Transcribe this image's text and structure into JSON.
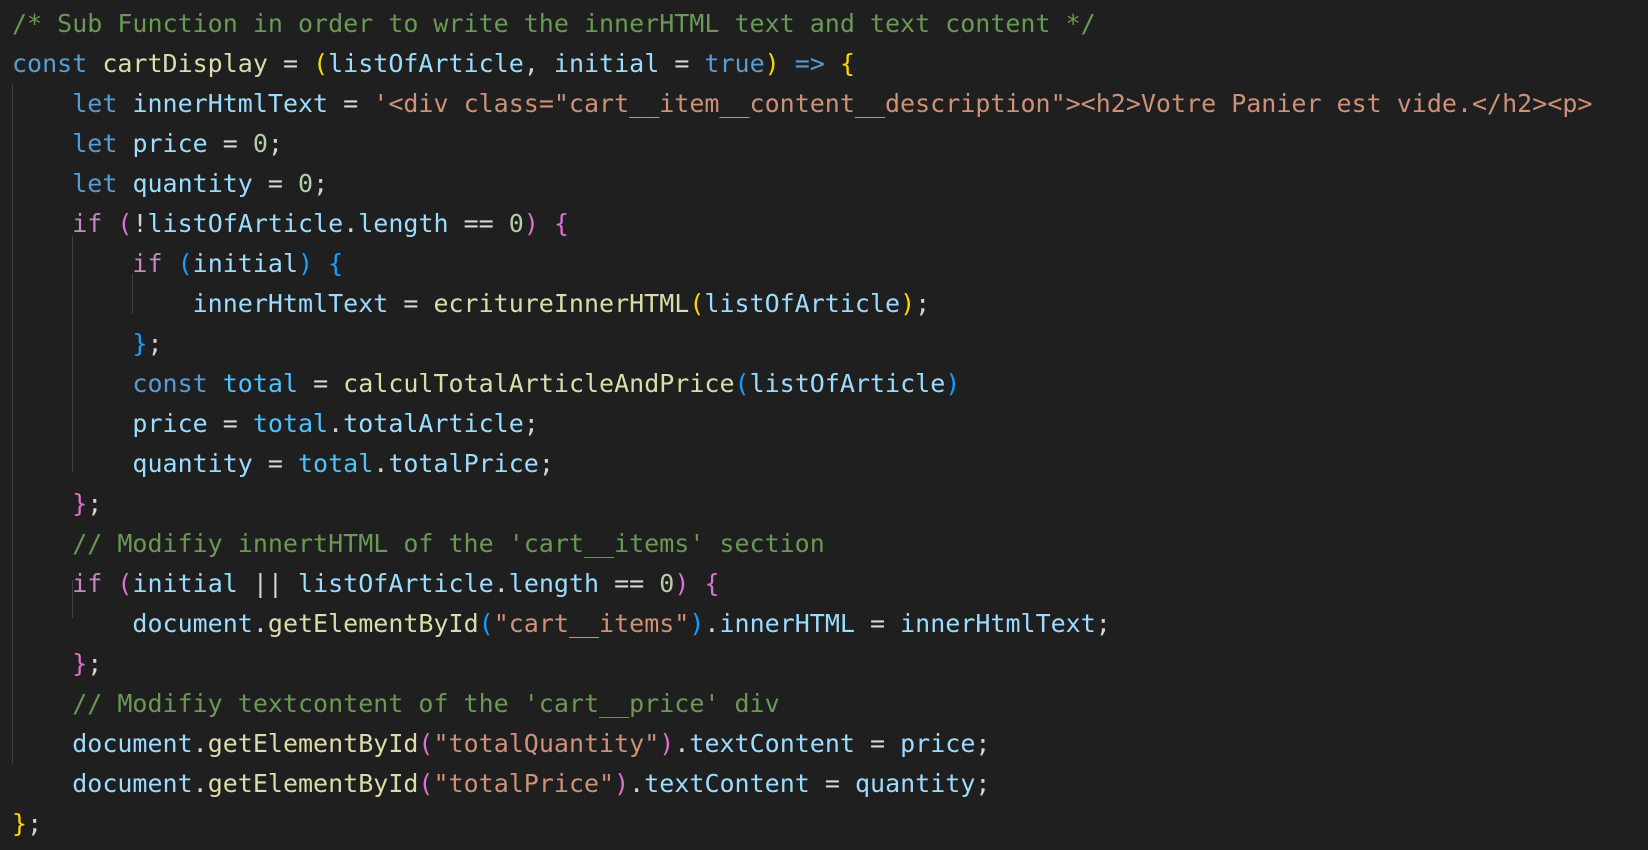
{
  "editor": {
    "theme_colors": {
      "background": "#1f1f1f",
      "plain": "#d4d4d4",
      "comment": "#6a9955",
      "keyword_storage": "#569cd6",
      "keyword_control": "#c586c0",
      "function": "#dcdcaa",
      "variable": "#9cdcfe",
      "constant": "#4fc1ff",
      "string": "#ce9178",
      "number": "#b5cea8",
      "bracket_gold": "#ffd700",
      "bracket_pink": "#da70d6",
      "bracket_blue": "#179fff",
      "indent_guide": "#404040"
    },
    "lines": [
      [
        {
          "t": "/* Sub Function in order to write the innerHTML text and text content */",
          "c": "comment"
        }
      ],
      [
        {
          "t": "const",
          "c": "keyword_storage"
        },
        {
          "t": " ",
          "c": "plain"
        },
        {
          "t": "cartDisplay",
          "c": "function"
        },
        {
          "t": " = ",
          "c": "plain"
        },
        {
          "t": "(",
          "c": "bracket_gold"
        },
        {
          "t": "listOfArticle",
          "c": "variable"
        },
        {
          "t": ", ",
          "c": "plain"
        },
        {
          "t": "initial",
          "c": "variable"
        },
        {
          "t": " = ",
          "c": "plain"
        },
        {
          "t": "true",
          "c": "keyword_storage"
        },
        {
          "t": ")",
          "c": "bracket_gold"
        },
        {
          "t": " ",
          "c": "plain"
        },
        {
          "t": "=>",
          "c": "keyword_storage"
        },
        {
          "t": " ",
          "c": "plain"
        },
        {
          "t": "{",
          "c": "bracket_gold"
        }
      ],
      [
        {
          "t": "    ",
          "c": "plain"
        },
        {
          "t": "let",
          "c": "keyword_storage"
        },
        {
          "t": " ",
          "c": "plain"
        },
        {
          "t": "innerHtmlText",
          "c": "variable"
        },
        {
          "t": " = ",
          "c": "plain"
        },
        {
          "t": "'<div class=\"cart__item__content__description\"><h2>Votre Panier est vide.</h2><p>",
          "c": "string"
        }
      ],
      [
        {
          "t": "    ",
          "c": "plain"
        },
        {
          "t": "let",
          "c": "keyword_storage"
        },
        {
          "t": " ",
          "c": "plain"
        },
        {
          "t": "price",
          "c": "variable"
        },
        {
          "t": " = ",
          "c": "plain"
        },
        {
          "t": "0",
          "c": "number"
        },
        {
          "t": ";",
          "c": "plain"
        }
      ],
      [
        {
          "t": "    ",
          "c": "plain"
        },
        {
          "t": "let",
          "c": "keyword_storage"
        },
        {
          "t": " ",
          "c": "plain"
        },
        {
          "t": "quantity",
          "c": "variable"
        },
        {
          "t": " = ",
          "c": "plain"
        },
        {
          "t": "0",
          "c": "number"
        },
        {
          "t": ";",
          "c": "plain"
        }
      ],
      [
        {
          "t": "    ",
          "c": "plain"
        },
        {
          "t": "if",
          "c": "keyword_control"
        },
        {
          "t": " ",
          "c": "plain"
        },
        {
          "t": "(",
          "c": "bracket_pink"
        },
        {
          "t": "!",
          "c": "plain"
        },
        {
          "t": "listOfArticle",
          "c": "variable"
        },
        {
          "t": ".",
          "c": "plain"
        },
        {
          "t": "length",
          "c": "variable"
        },
        {
          "t": " == ",
          "c": "plain"
        },
        {
          "t": "0",
          "c": "number"
        },
        {
          "t": ")",
          "c": "bracket_pink"
        },
        {
          "t": " ",
          "c": "plain"
        },
        {
          "t": "{",
          "c": "bracket_pink"
        }
      ],
      [
        {
          "t": "        ",
          "c": "plain"
        },
        {
          "t": "if",
          "c": "keyword_control"
        },
        {
          "t": " ",
          "c": "plain"
        },
        {
          "t": "(",
          "c": "bracket_blue"
        },
        {
          "t": "initial",
          "c": "variable"
        },
        {
          "t": ")",
          "c": "bracket_blue"
        },
        {
          "t": " ",
          "c": "plain"
        },
        {
          "t": "{",
          "c": "bracket_blue"
        }
      ],
      [
        {
          "t": "            ",
          "c": "plain"
        },
        {
          "t": "innerHtmlText",
          "c": "variable"
        },
        {
          "t": " = ",
          "c": "plain"
        },
        {
          "t": "ecritureInnerHTML",
          "c": "function"
        },
        {
          "t": "(",
          "c": "bracket_gold"
        },
        {
          "t": "listOfArticle",
          "c": "variable"
        },
        {
          "t": ")",
          "c": "bracket_gold"
        },
        {
          "t": ";",
          "c": "plain"
        }
      ],
      [
        {
          "t": "        ",
          "c": "plain"
        },
        {
          "t": "}",
          "c": "bracket_blue"
        },
        {
          "t": ";",
          "c": "plain"
        }
      ],
      [
        {
          "t": "        ",
          "c": "plain"
        },
        {
          "t": "const",
          "c": "keyword_storage"
        },
        {
          "t": " ",
          "c": "plain"
        },
        {
          "t": "total",
          "c": "constant"
        },
        {
          "t": " = ",
          "c": "plain"
        },
        {
          "t": "calculTotalArticleAndPrice",
          "c": "function"
        },
        {
          "t": "(",
          "c": "bracket_blue"
        },
        {
          "t": "listOfArticle",
          "c": "variable"
        },
        {
          "t": ")",
          "c": "bracket_blue"
        }
      ],
      [
        {
          "t": "        ",
          "c": "plain"
        },
        {
          "t": "price",
          "c": "variable"
        },
        {
          "t": " = ",
          "c": "plain"
        },
        {
          "t": "total",
          "c": "constant"
        },
        {
          "t": ".",
          "c": "plain"
        },
        {
          "t": "totalArticle",
          "c": "variable"
        },
        {
          "t": ";",
          "c": "plain"
        }
      ],
      [
        {
          "t": "        ",
          "c": "plain"
        },
        {
          "t": "quantity",
          "c": "variable"
        },
        {
          "t": " = ",
          "c": "plain"
        },
        {
          "t": "total",
          "c": "constant"
        },
        {
          "t": ".",
          "c": "plain"
        },
        {
          "t": "totalPrice",
          "c": "variable"
        },
        {
          "t": ";",
          "c": "plain"
        }
      ],
      [
        {
          "t": "    ",
          "c": "plain"
        },
        {
          "t": "}",
          "c": "bracket_pink"
        },
        {
          "t": ";",
          "c": "plain"
        }
      ],
      [
        {
          "t": "    ",
          "c": "plain"
        },
        {
          "t": "// Modifiy innertHTML of the 'cart__items' section",
          "c": "comment"
        }
      ],
      [
        {
          "t": "    ",
          "c": "plain"
        },
        {
          "t": "if",
          "c": "keyword_control"
        },
        {
          "t": " ",
          "c": "plain"
        },
        {
          "t": "(",
          "c": "bracket_pink"
        },
        {
          "t": "initial",
          "c": "variable"
        },
        {
          "t": " || ",
          "c": "plain"
        },
        {
          "t": "listOfArticle",
          "c": "variable"
        },
        {
          "t": ".",
          "c": "plain"
        },
        {
          "t": "length",
          "c": "variable"
        },
        {
          "t": " == ",
          "c": "plain"
        },
        {
          "t": "0",
          "c": "number"
        },
        {
          "t": ")",
          "c": "bracket_pink"
        },
        {
          "t": " ",
          "c": "plain"
        },
        {
          "t": "{",
          "c": "bracket_pink"
        }
      ],
      [
        {
          "t": "        ",
          "c": "plain"
        },
        {
          "t": "document",
          "c": "variable"
        },
        {
          "t": ".",
          "c": "plain"
        },
        {
          "t": "getElementById",
          "c": "function"
        },
        {
          "t": "(",
          "c": "bracket_blue"
        },
        {
          "t": "\"cart__items\"",
          "c": "string"
        },
        {
          "t": ")",
          "c": "bracket_blue"
        },
        {
          "t": ".",
          "c": "plain"
        },
        {
          "t": "innerHTML",
          "c": "variable"
        },
        {
          "t": " = ",
          "c": "plain"
        },
        {
          "t": "innerHtmlText",
          "c": "variable"
        },
        {
          "t": ";",
          "c": "plain"
        }
      ],
      [
        {
          "t": "    ",
          "c": "plain"
        },
        {
          "t": "}",
          "c": "bracket_pink"
        },
        {
          "t": ";",
          "c": "plain"
        }
      ],
      [
        {
          "t": "    ",
          "c": "plain"
        },
        {
          "t": "// Modifiy textcontent of the 'cart__price' div",
          "c": "comment"
        }
      ],
      [
        {
          "t": "    ",
          "c": "plain"
        },
        {
          "t": "document",
          "c": "variable"
        },
        {
          "t": ".",
          "c": "plain"
        },
        {
          "t": "getElementById",
          "c": "function"
        },
        {
          "t": "(",
          "c": "bracket_pink"
        },
        {
          "t": "\"totalQuantity\"",
          "c": "string"
        },
        {
          "t": ")",
          "c": "bracket_pink"
        },
        {
          "t": ".",
          "c": "plain"
        },
        {
          "t": "textContent",
          "c": "variable"
        },
        {
          "t": " = ",
          "c": "plain"
        },
        {
          "t": "price",
          "c": "variable"
        },
        {
          "t": ";",
          "c": "plain"
        }
      ],
      [
        {
          "t": "    ",
          "c": "plain"
        },
        {
          "t": "document",
          "c": "variable"
        },
        {
          "t": ".",
          "c": "plain"
        },
        {
          "t": "getElementById",
          "c": "function"
        },
        {
          "t": "(",
          "c": "bracket_pink"
        },
        {
          "t": "\"totalPrice\"",
          "c": "string"
        },
        {
          "t": ")",
          "c": "bracket_pink"
        },
        {
          "t": ".",
          "c": "plain"
        },
        {
          "t": "textContent",
          "c": "variable"
        },
        {
          "t": " = ",
          "c": "plain"
        },
        {
          "t": "quantity",
          "c": "variable"
        },
        {
          "t": ";",
          "c": "plain"
        }
      ],
      [
        {
          "t": "}",
          "c": "bracket_gold"
        },
        {
          "t": ";",
          "c": "plain"
        }
      ]
    ]
  }
}
